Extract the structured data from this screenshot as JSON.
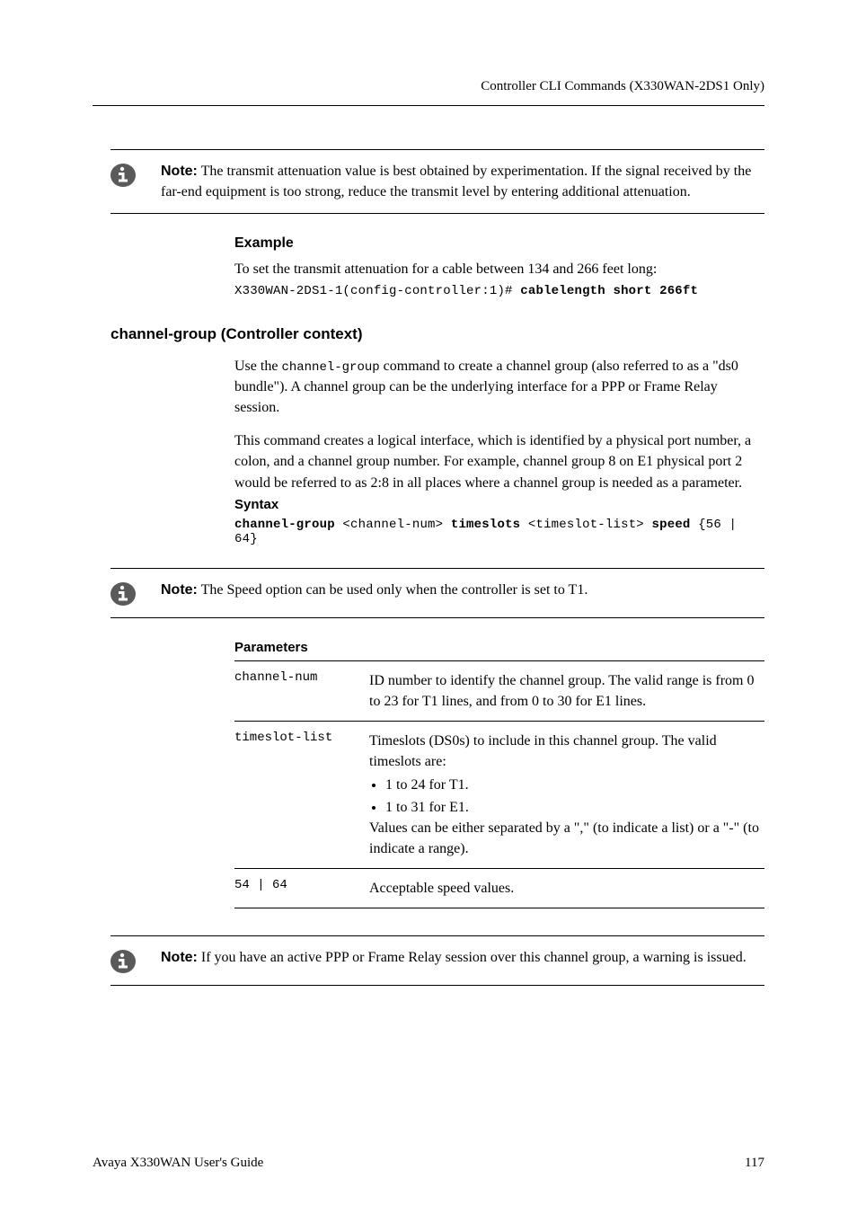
{
  "header": {
    "title": "Controller CLI Commands (X330WAN-2DS1 Only)"
  },
  "note1": {
    "label": "Note:",
    "text": "The transmit attenuation value is best obtained by experimentation. If the signal received by the far-end equipment is too strong, reduce the transmit level by entering additional attenuation."
  },
  "example": {
    "header": "Example",
    "intro": "To set the transmit attenuation for a cable between 134 and 266 feet long:",
    "code_prefix": "X330WAN-2DS1-1(config-controller:1)# ",
    "code_bold": "cablelength short 266ft"
  },
  "subsection": {
    "title": "channel-group (Controller context)",
    "para1_pre": "Use the ",
    "para1_code": "channel-group",
    "para1_post": " command to create a channel group (also referred to as a \"ds0 bundle\"). A channel group can be the underlying interface for a PPP or Frame Relay session.",
    "para2": "This command creates a logical interface, which is identified by a physical port number, a colon, and a channel group number. For example, channel group 8 on E1 physical port 2 would be referred to as 2:8 in all places where a channel group is needed as a parameter."
  },
  "syntax": {
    "header": "Syntax",
    "p1": "channel-group",
    "p2": " <channel-num> ",
    "p3": "timeslots",
    "p4": " <timeslot-list> ",
    "p5": "speed",
    "p6": " {56 | 64}"
  },
  "note2": {
    "label": "Note:",
    "text": "The Speed option can be used only when the controller is set to T1."
  },
  "parameters": {
    "header": "Parameters",
    "rows": [
      {
        "name": "channel-num",
        "desc": "ID number to identify the channel group. The valid range is from 0 to 23 for T1 lines, and from 0 to 30 for E1 lines."
      },
      {
        "name": "timeslot-list",
        "desc_intro": "Timeslots (DS0s) to include in this channel group. The valid timeslots are:",
        "bullets": [
          "1 to 24 for T1.",
          "1 to 31 for E1."
        ],
        "desc_outro": "Values can be either separated by a \",\" (to indicate a list) or a \"-\" (to indicate a range)."
      },
      {
        "name": "54 | 64",
        "desc": "Acceptable speed values."
      }
    ]
  },
  "note3": {
    "label": "Note:",
    "text": "If you have an active PPP or Frame Relay session over this channel group, a warning is issued."
  },
  "footer": {
    "left": "Avaya X330WAN User's Guide",
    "right": "117"
  }
}
